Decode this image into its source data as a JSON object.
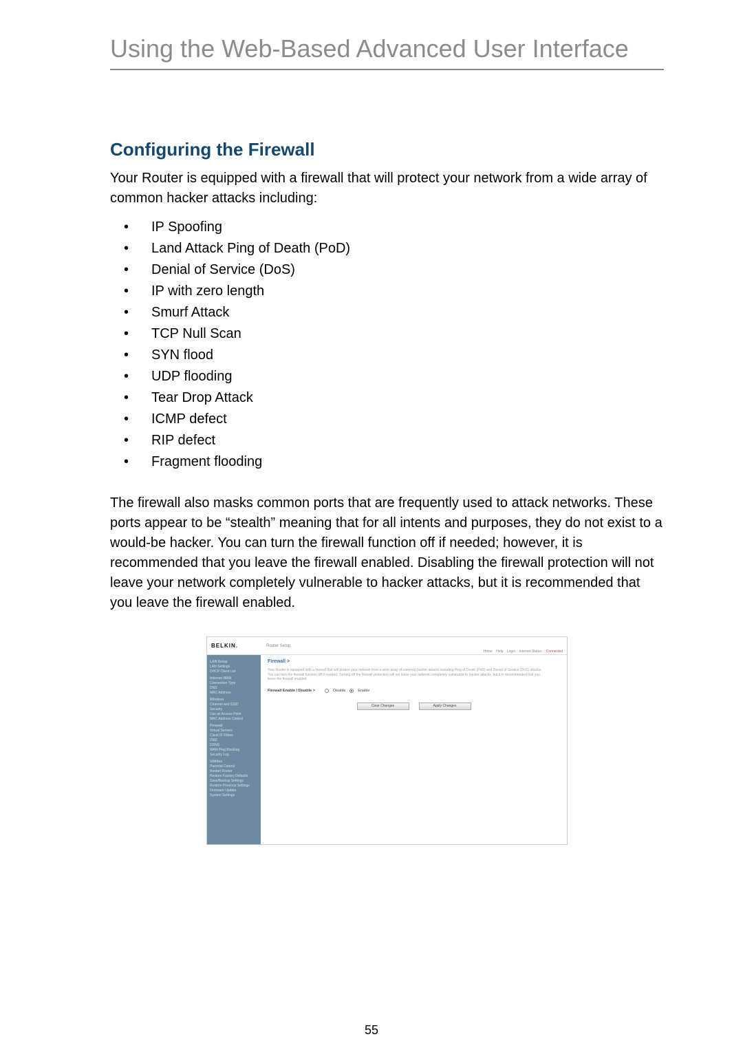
{
  "page": {
    "chapter_title": "Using the Web-Based Advanced User Interface",
    "section_title": "Configuring the Firewall",
    "intro": "Your Router is equipped with a firewall that will protect your network from a wide array of common hacker attacks including:",
    "attacks": [
      "IP Spoofing",
      "Land Attack Ping of Death (PoD)",
      "Denial of Service (DoS)",
      "IP with zero length",
      "Smurf Attack",
      "TCP Null Scan",
      "SYN flood",
      "UDP flooding",
      "Tear Drop Attack",
      "ICMP defect",
      "RIP defect",
      "Fragment flooding"
    ],
    "followup": "The firewall also masks common ports that are frequently used to attack networks. These ports appear to be “stealth” meaning that for all intents and purposes, they do not exist to a would-be hacker. You can turn the firewall function off if needed; however, it is recommended that you leave the firewall enabled. Disabling the firewall protection will not leave your network completely vulnerable to hacker attacks, but it is recommended that you leave the firewall enabled.",
    "number": "55"
  },
  "screenshot": {
    "brand": "BELKIN.",
    "top_subtitle": "Router Setup",
    "top_right": {
      "a": "Home",
      "b": "Help",
      "c": "Login",
      "d": "Internet Status:",
      "e": "Connected"
    },
    "sidebar": {
      "groups": [
        {
          "label": "LAN Setup",
          "items": [
            "LAN Settings",
            "DHCP Client List"
          ]
        },
        {
          "label": "Internet WAN",
          "items": [
            "Connection Type",
            "DNS",
            "MAC Address"
          ]
        },
        {
          "label": "Wireless",
          "items": [
            "Channel and SSID",
            "Security",
            "Use as Access Point",
            "MAC Address Control"
          ]
        },
        {
          "label": "Firewall",
          "items": [
            "Virtual Servers",
            "Client IP Filters",
            "DMZ",
            "DDNS",
            "WAN Ping Blocking",
            "Security Log"
          ]
        },
        {
          "label": "Utilities",
          "items": [
            "Parental Control",
            "Restart Router",
            "Restore Factory Defaults",
            "Save/Backup Settings",
            "Restore Previous Settings",
            "Firmware Update",
            "System Settings"
          ]
        }
      ]
    },
    "main": {
      "title": "Firewall >",
      "desc1": "Your Router is equipped with a firewall that will protect your network from a wide array of common hacker attacks including Ping of Death (PoD) and Denial of Service (DoS) attacks. You can turn the firewall function off if needed. Turning off the firewall protection will not leave your network completely vulnerable to hacker attacks, but it is recommended that you leave the firewall enabled.",
      "radio_label": "Firewall Enable / Disable >",
      "radio_disable": "Disable",
      "radio_enable": "Enable",
      "btn_clear": "Clear Changes",
      "btn_apply": "Apply Changes"
    }
  }
}
